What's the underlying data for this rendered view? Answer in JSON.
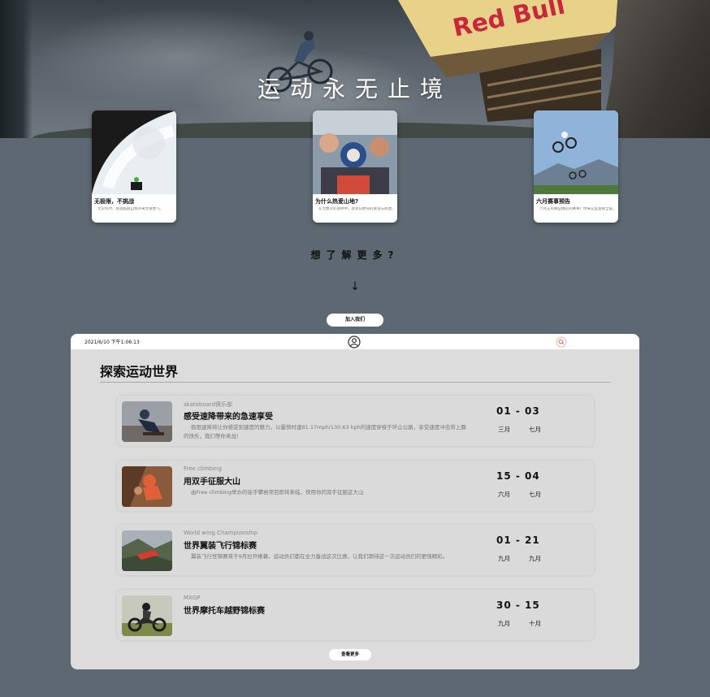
{
  "hero": {
    "title": "运动永无止境",
    "brand_text": "Red Bull"
  },
  "cards": [
    {
      "title": "无极限，不挑战",
      "text": "无论何时，感受超越自我带来无限勇气。"
    },
    {
      "title": "为什么热爱山地?",
      "text": "在无数次的速降中，感受山野间的紧张与刺激。"
    },
    {
      "title": "六月赛事预告",
      "text": "六月又有哪些精彩的赛事？你来这里查看全部。"
    }
  ],
  "cta": {
    "question": "想了解更多?",
    "arrow": "↓",
    "join_label": "加入我们"
  },
  "panel": {
    "datetime": "2021/6/10 下午1:06:13",
    "section_title": "探索运动世界",
    "view_more_label": "查看更多",
    "events": [
      {
        "tag": "skateboard俱乐部",
        "title": "感受速降带来的急速享受",
        "desc": "极限速降将让你感受到速度的魅力，以最快时速81.17mph/130.63 kph的速度穿梭于环山公路，享受速度冲击背上腺的快乐，我们等你来战!",
        "dates": "01 - 03",
        "month_start": "三月",
        "month_end": "七月"
      },
      {
        "tag": "Free climbing",
        "title": "用双手征服大山",
        "desc": "由Free climbing举办的徒手攀岩项目即将来临，快用你的双手征服这大山",
        "dates": "15 - 04",
        "month_start": "六月",
        "month_end": "七月"
      },
      {
        "tag": "World wing Championship",
        "title": "世界翼装飞行锦标赛",
        "desc": "翼装飞行世锦赛将于9月拉开帷幕，运动员们都在全力备战这次比赛，让我们期待这一次运动员们的更强精彩。",
        "dates": "01 - 21",
        "month_start": "九月",
        "month_end": "九月"
      },
      {
        "tag": "MXGP",
        "title": "世界摩托车越野锦标赛",
        "desc": "",
        "dates": "30 - 15",
        "month_start": "九月",
        "month_end": "十月"
      }
    ]
  },
  "colors": {
    "page_bg": "#5d6872",
    "panel_bg": "#dcdcdc",
    "search_accent": "#e2735a"
  }
}
